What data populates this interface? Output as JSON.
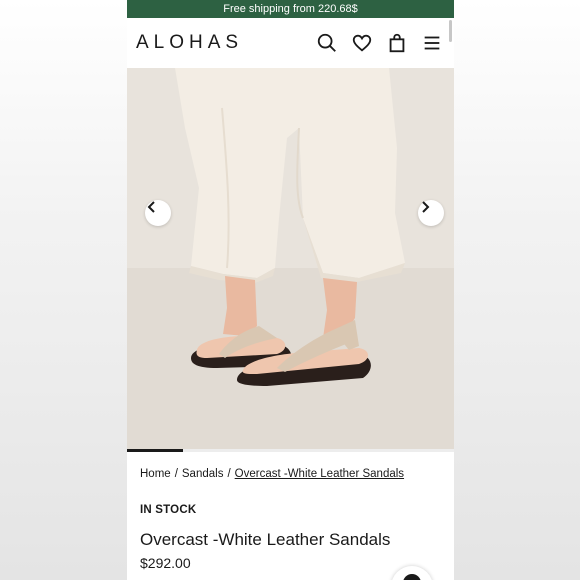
{
  "banner": {
    "text": "Free shipping from 220.68$"
  },
  "header": {
    "logo": "ALOHAS",
    "icons": [
      "search-icon",
      "heart-icon",
      "bag-icon",
      "menu-icon"
    ]
  },
  "gallery": {
    "image_alt": "Woman wearing beige leather flip-flop platform sandals",
    "progress": 0.17
  },
  "breadcrumb": {
    "items": [
      "Home",
      "Sandals",
      "Overcast -White Leather Sandals"
    ],
    "separator": "/"
  },
  "product": {
    "stock": "IN STOCK",
    "title": "Overcast -White Leather Sandals",
    "price": "$292.00"
  },
  "colors": {
    "banner": "#2d6142",
    "text": "#1a1a1a"
  }
}
